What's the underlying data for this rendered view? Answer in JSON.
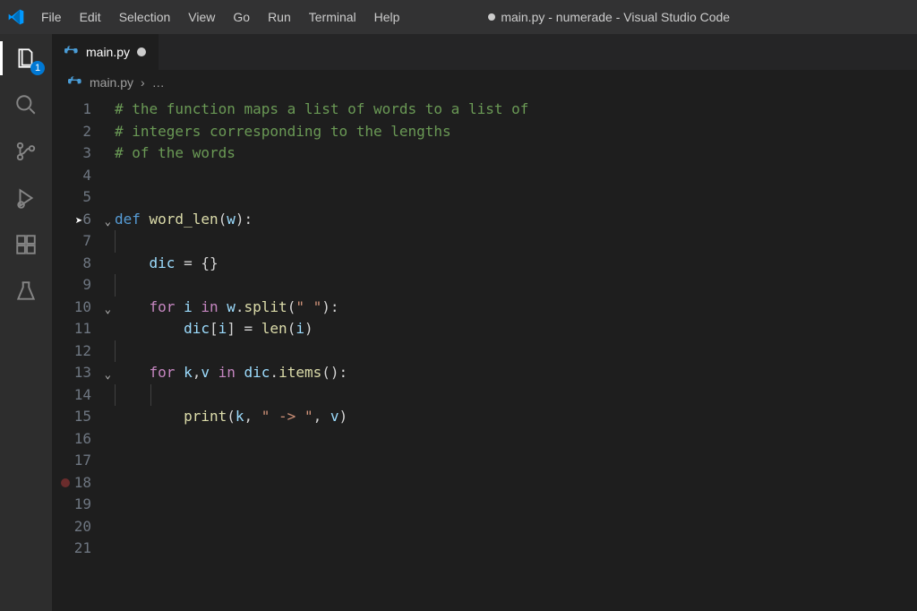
{
  "menu": {
    "items": [
      "File",
      "Edit",
      "Selection",
      "View",
      "Go",
      "Run",
      "Terminal",
      "Help"
    ]
  },
  "windowTitle": "main.py - numerade - Visual Studio Code",
  "activity": {
    "explorerBadge": "1"
  },
  "tab": {
    "filename": "main.py"
  },
  "breadcrumb": {
    "filename": "main.py",
    "ellipsis": "…"
  },
  "code": {
    "lineCount": 21,
    "lines": [
      {
        "n": 1,
        "fold": "",
        "tokens": [
          [
            "comment",
            "# the function maps a list of words to a list of"
          ]
        ]
      },
      {
        "n": 2,
        "fold": "",
        "tokens": [
          [
            "comment",
            "# integers corresponding to the lengths"
          ]
        ]
      },
      {
        "n": 3,
        "fold": "",
        "tokens": [
          [
            "comment",
            "# of the words"
          ]
        ]
      },
      {
        "n": 4,
        "fold": "",
        "tokens": []
      },
      {
        "n": 5,
        "fold": "",
        "tokens": []
      },
      {
        "n": 6,
        "fold": "v",
        "tokens": [
          [
            "keyword",
            "def "
          ],
          [
            "func",
            "word_len"
          ],
          [
            "punct",
            "("
          ],
          [
            "param",
            "w"
          ],
          [
            "punct",
            "):"
          ]
        ]
      },
      {
        "n": 7,
        "fold": "",
        "tokens": [
          [
            "guide",
            ""
          ]
        ]
      },
      {
        "n": 8,
        "fold": "",
        "tokens": [
          [
            "indent",
            "    "
          ],
          [
            "param",
            "dic"
          ],
          [
            "punct",
            " = {}"
          ]
        ]
      },
      {
        "n": 9,
        "fold": "",
        "tokens": [
          [
            "guide",
            ""
          ]
        ]
      },
      {
        "n": 10,
        "fold": "v",
        "tokens": [
          [
            "indent",
            "    "
          ],
          [
            "control",
            "for "
          ],
          [
            "param",
            "i"
          ],
          [
            "control",
            " in "
          ],
          [
            "param",
            "w"
          ],
          [
            "punct",
            "."
          ],
          [
            "func",
            "split"
          ],
          [
            "punct",
            "("
          ],
          [
            "string",
            "\" \""
          ],
          [
            "punct",
            "):"
          ]
        ]
      },
      {
        "n": 11,
        "fold": "",
        "tokens": [
          [
            "indent",
            "        "
          ],
          [
            "param",
            "dic"
          ],
          [
            "punct",
            "["
          ],
          [
            "param",
            "i"
          ],
          [
            "punct",
            "] = "
          ],
          [
            "builtin",
            "len"
          ],
          [
            "punct",
            "("
          ],
          [
            "param",
            "i"
          ],
          [
            "punct",
            ")"
          ]
        ]
      },
      {
        "n": 12,
        "fold": "",
        "tokens": [
          [
            "guide",
            ""
          ]
        ]
      },
      {
        "n": 13,
        "fold": "v",
        "tokens": [
          [
            "indent",
            "    "
          ],
          [
            "control",
            "for "
          ],
          [
            "param",
            "k"
          ],
          [
            "punct",
            ","
          ],
          [
            "param",
            "v"
          ],
          [
            "control",
            " in "
          ],
          [
            "param",
            "dic"
          ],
          [
            "punct",
            "."
          ],
          [
            "func",
            "items"
          ],
          [
            "punct",
            "():"
          ]
        ]
      },
      {
        "n": 14,
        "fold": "",
        "tokens": [
          [
            "guide2",
            ""
          ]
        ]
      },
      {
        "n": 15,
        "fold": "",
        "tokens": [
          [
            "indent",
            "        "
          ],
          [
            "builtin",
            "print"
          ],
          [
            "punct",
            "("
          ],
          [
            "param",
            "k"
          ],
          [
            "punct",
            ", "
          ],
          [
            "string",
            "\" -> \""
          ],
          [
            "punct",
            ", "
          ],
          [
            "param",
            "v"
          ],
          [
            "punct",
            ")"
          ]
        ]
      },
      {
        "n": 16,
        "fold": "",
        "tokens": []
      },
      {
        "n": 17,
        "fold": "",
        "tokens": []
      },
      {
        "n": 18,
        "fold": "",
        "tokens": []
      },
      {
        "n": 19,
        "fold": "",
        "tokens": []
      },
      {
        "n": 20,
        "fold": "",
        "tokens": []
      },
      {
        "n": 21,
        "fold": "",
        "tokens": []
      }
    ]
  }
}
